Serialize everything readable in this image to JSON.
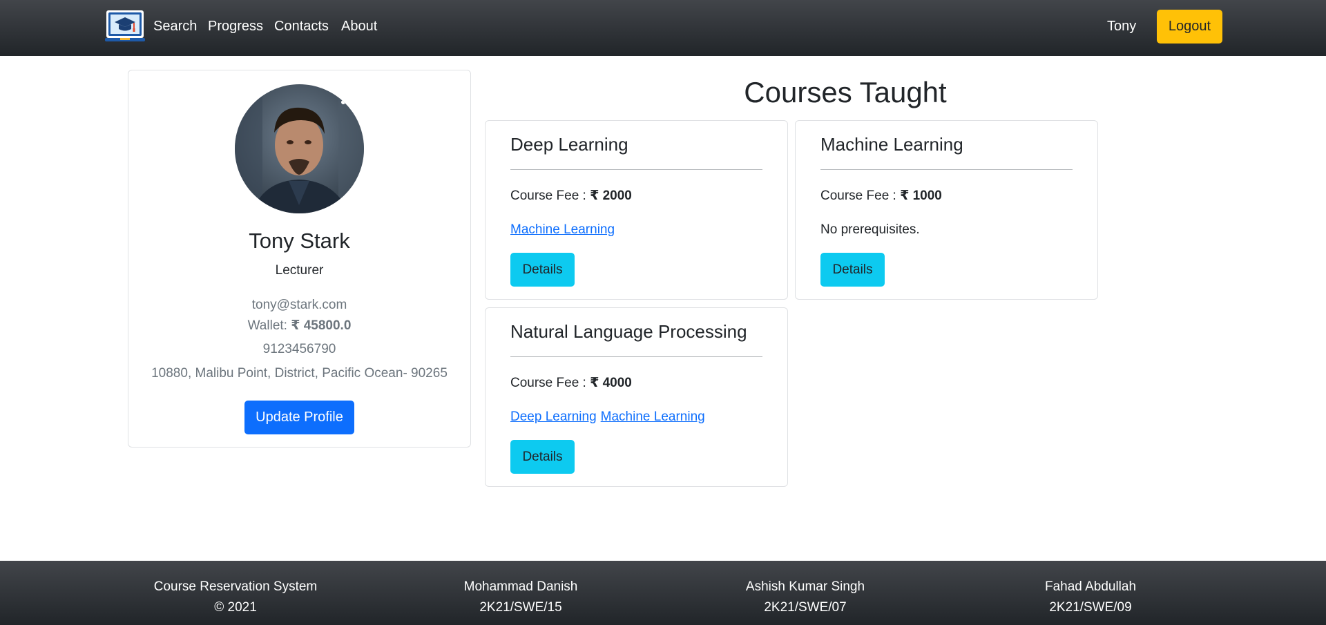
{
  "navbar": {
    "brand_icon": "graduation-cap-laptop-icon",
    "links": [
      "Search",
      "Progress",
      "Contacts",
      "About"
    ],
    "user": "Tony",
    "logout_label": "Logout"
  },
  "profile": {
    "name": "Tony Stark",
    "role": "Lecturer",
    "email": "tony@stark.com",
    "wallet_label": "Wallet: ",
    "wallet_value": "₹ 45800.0",
    "phone": "9123456790",
    "address": "10880, Malibu Point, District, Pacific Ocean- 90265",
    "update_label": "Update Profile"
  },
  "courses": {
    "title": "Courses Taught",
    "fee_label": "Course Fee : ",
    "details_label": "Details",
    "items": [
      {
        "name": "Deep Learning",
        "fee": "₹ 2000",
        "prerequisites": [
          "Machine Learning"
        ],
        "no_prereq_text": ""
      },
      {
        "name": "Machine Learning",
        "fee": "₹ 1000",
        "prerequisites": [],
        "no_prereq_text": "No prerequisites."
      },
      {
        "name": "Natural Language Processing",
        "fee": "₹ 4000",
        "prerequisites": [
          "Deep Learning",
          "Machine Learning"
        ],
        "no_prereq_text": ""
      }
    ]
  },
  "footer": {
    "columns": [
      {
        "line1": "Course Reservation System",
        "line2": "© 2021"
      },
      {
        "line1": "Mohammad Danish",
        "line2": "2K21/SWE/15"
      },
      {
        "line1": "Ashish Kumar Singh",
        "line2": "2K21/SWE/07"
      },
      {
        "line1": "Fahad Abdullah",
        "line2": "2K21/SWE/09"
      }
    ]
  },
  "colors": {
    "navbar": "#212529",
    "logout": "#ffc107",
    "primary": "#0d6efd",
    "info": "#0dcaf0",
    "muted": "#6c757d"
  }
}
